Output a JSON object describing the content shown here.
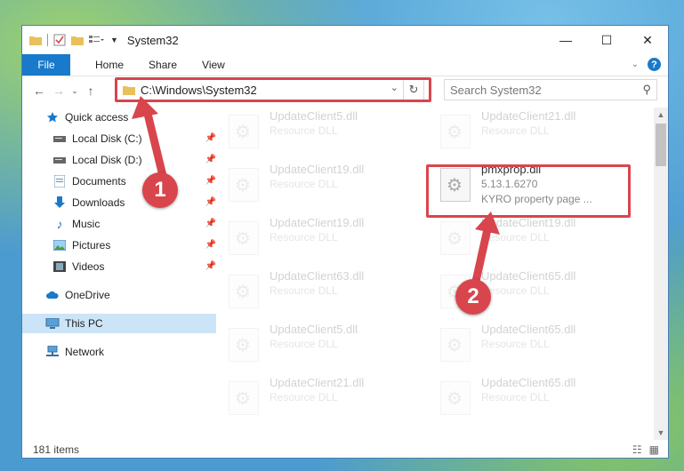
{
  "window": {
    "title": "System32",
    "controls": {
      "minimize": "—",
      "maximize": "☐",
      "close": "✕"
    }
  },
  "ribbon": {
    "tabs": [
      "File",
      "Home",
      "Share",
      "View"
    ]
  },
  "address": {
    "path": "C:\\Windows\\System32",
    "search_placeholder": "Search System32"
  },
  "sidebar": {
    "items": [
      {
        "label": "Quick access",
        "icon": "star-icon",
        "pinned": false
      },
      {
        "label": "Local Disk (C:)",
        "icon": "drive-icon",
        "pinned": true
      },
      {
        "label": "Local Disk (D:)",
        "icon": "drive-icon",
        "pinned": true
      },
      {
        "label": "Documents",
        "icon": "documents-icon",
        "pinned": true
      },
      {
        "label": "Downloads",
        "icon": "downloads-icon",
        "pinned": true
      },
      {
        "label": "Music",
        "icon": "music-icon",
        "pinned": true
      },
      {
        "label": "Pictures",
        "icon": "pictures-icon",
        "pinned": true
      },
      {
        "label": "Videos",
        "icon": "videos-icon",
        "pinned": true
      },
      {
        "label": "OneDrive",
        "icon": "cloud-icon",
        "pinned": false
      },
      {
        "label": "This PC",
        "icon": "computer-icon",
        "pinned": false,
        "selected": true
      },
      {
        "label": "Network",
        "icon": "network-icon",
        "pinned": false
      }
    ]
  },
  "files": {
    "left": [
      {
        "name": "UpdateClient5.dll",
        "desc": "Resource DLL"
      },
      {
        "name": "UpdateClient19.dll",
        "desc": "Resource DLL"
      },
      {
        "name": "UpdateClient19.dll",
        "desc": "Resource DLL"
      },
      {
        "name": "UpdateClient63.dll",
        "desc": "Resource DLL"
      },
      {
        "name": "UpdateClient5.dll",
        "desc": "Resource DLL"
      },
      {
        "name": "UpdateClient21.dll",
        "desc": "Resource DLL"
      }
    ],
    "right": [
      {
        "name": "UpdateClient21.dll",
        "desc": "Resource DLL"
      },
      {
        "name": "pmxprop.dll",
        "desc": "5.13.1.6270",
        "extra": "KYRO property page ..."
      },
      {
        "name": "UpdateClient19.dll",
        "desc": "Resource DLL"
      },
      {
        "name": "UpdateClient65.dll",
        "desc": "Resource DLL"
      },
      {
        "name": "UpdateClient65.dll",
        "desc": "Resource DLL"
      },
      {
        "name": "UpdateClient65.dll",
        "desc": "Resource DLL"
      }
    ]
  },
  "status": {
    "count": "181 items"
  },
  "callouts": {
    "one": "1",
    "two": "2"
  },
  "colors": {
    "accent": "#1979ca",
    "highlight": "#d9454c",
    "selected": "#cce4f7"
  }
}
